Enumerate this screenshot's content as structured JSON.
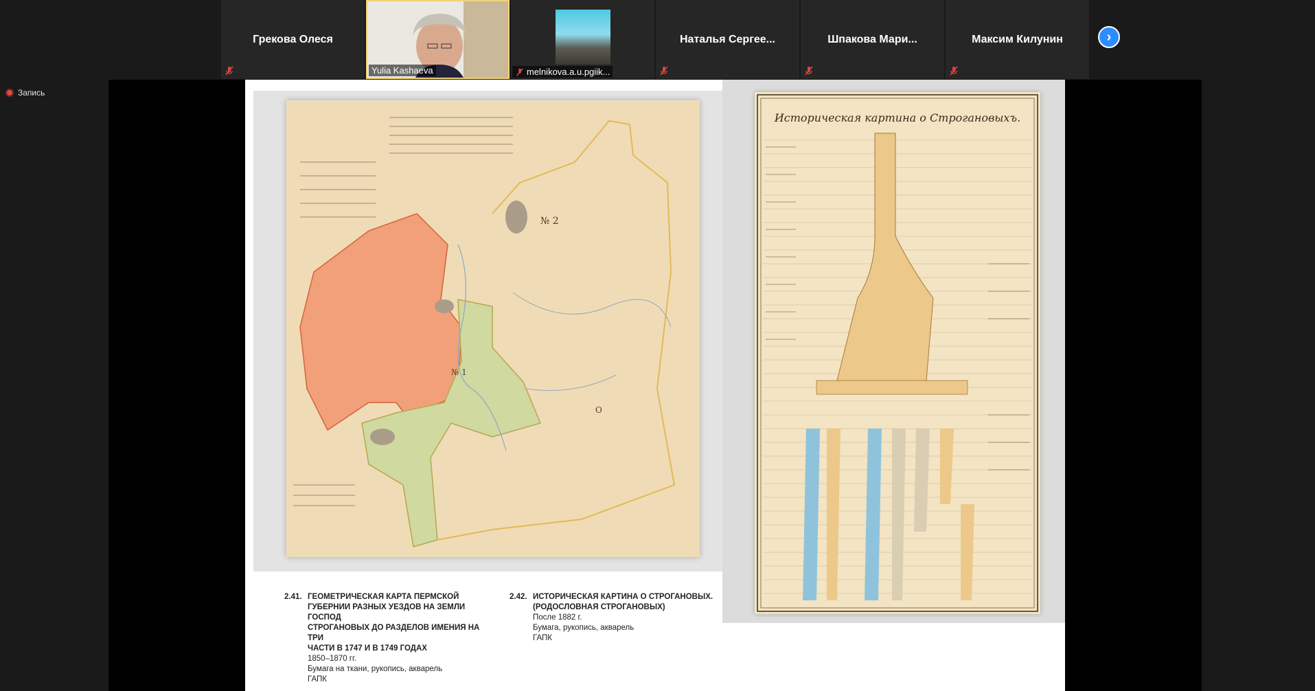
{
  "participants": [
    {
      "name": "Грекова Олеся",
      "muted": true
    },
    {
      "name": "Yulia Kashaeva",
      "muted": false,
      "video": true
    },
    {
      "name": "melnikova.a.u.pgiik...",
      "muted": true,
      "video": true
    },
    {
      "name": "Наталья   Сергее...",
      "muted": true
    },
    {
      "name": "Шпакова  Мари...",
      "muted": true
    },
    {
      "name": "Максим Килунин",
      "muted": true
    }
  ],
  "recording_label": "Запись",
  "next_icon": "chevron-right-icon",
  "slide": {
    "genealogy_title": "Историческая картина о Строгановыхъ.",
    "map_labels": [
      "№ 2",
      "№ 1",
      "О"
    ],
    "caption_left": {
      "number": "2.41.",
      "title_lines": [
        "ГЕОМЕТРИЧЕСКАЯ КАРТА ПЕРМСКОЙ",
        "ГУБЕРНИИ РАЗНЫХ УЕЗДОВ НА ЗЕМЛИ ГОСПОД",
        "СТРОГАНОВЫХ ДО РАЗДЕЛОВ ИМЕНИЯ НА ТРИ",
        "ЧАСТИ В 1747 И В 1749 ГОДАХ"
      ],
      "date": "1850–1870 гг.",
      "material": "Бумага на ткани, рукопись, акварель",
      "archive": "ГАПК"
    },
    "caption_right": {
      "number": "2.42.",
      "title_lines": [
        "ИСТОРИЧЕСКАЯ КАРТИНА О СТРОГАНОВЫХ.",
        "(РОДОСЛОВНАЯ СТРОГАНОВЫХ)"
      ],
      "date": "После 1882 г.",
      "material": "Бумага, рукопись, акварель",
      "archive": "ГАПК"
    }
  },
  "colors": {
    "accent": "#2d8cff",
    "recording": "#e8473f",
    "muted_icon": "#e0443e",
    "map_orange": "#f2a07a",
    "map_green": "#cfd9a0",
    "map_outline": "#e3b85a",
    "river_blue": "#8fc3dc"
  }
}
